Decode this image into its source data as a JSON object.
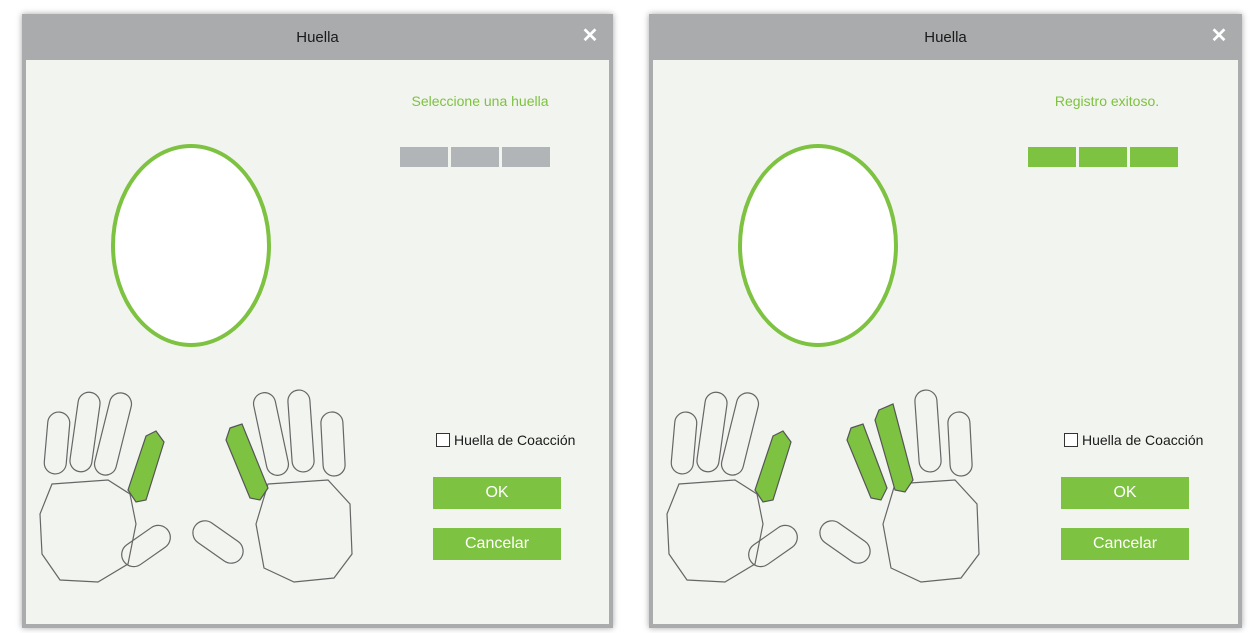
{
  "dialogs": [
    {
      "title": "Huella",
      "status": "Seleccione una huella",
      "progress": [
        "pending",
        "pending",
        "pending"
      ],
      "duress_label": "Huella de Coacción",
      "ok_label": "OK",
      "cancel_label": "Cancelar",
      "selected_fingers": [
        "left-index",
        "right-index"
      ]
    },
    {
      "title": "Huella",
      "status": "Registro exitoso.",
      "progress": [
        "done",
        "done",
        "done"
      ],
      "duress_label": "Huella de Coacción",
      "ok_label": "OK",
      "cancel_label": "Cancelar",
      "selected_fingers": [
        "left-index",
        "right-index",
        "right-middle"
      ]
    }
  ],
  "colors": {
    "accent": "#7dc241",
    "titlebar": "#a9abac",
    "dialog_bg": "#f2f4ef",
    "progress_pending": "#b2b5b7"
  },
  "icons": {
    "close": "close-icon",
    "hands": "hand-diagram-icon"
  }
}
